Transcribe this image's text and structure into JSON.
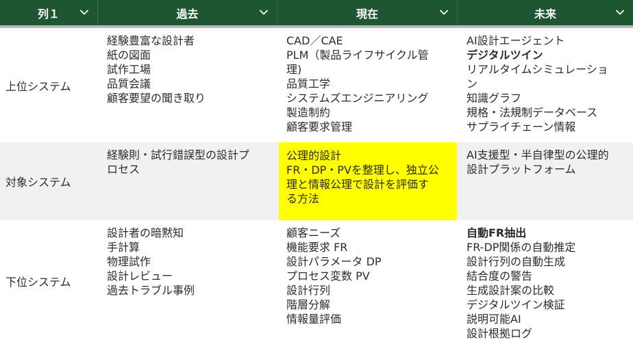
{
  "header": {
    "col0": "列１",
    "col1": "過去",
    "col2": "現在",
    "col3": "未来"
  },
  "rows": [
    {
      "label": "上位システム",
      "past": [
        "経験豊富な設計者",
        "紙の図面",
        "試作工場",
        "品質会議",
        "顧客要望の聞き取り"
      ],
      "present": [
        "CAD／CAE",
        "PLM（製品ライフサイクル管",
        "理)",
        "品質工学",
        "システムズエンジニアリング",
        "製造制約",
        "顧客要求管理"
      ],
      "future": [
        "AI設計エージェント",
        "デジタルツイン",
        "リアルタイムシミュレーショ",
        "ン",
        "知識グラフ",
        "規格・法規制データベース",
        "サプライチェーン情報"
      ]
    },
    {
      "label": "対象システム",
      "past": [
        "経験則・試行錯誤型の設計プ",
        "ロセス"
      ],
      "present": [
        "公理的設計",
        "FR・DP・PVを整理し、独立公",
        "理と情報公理で設計を評価す",
        "る方法"
      ],
      "future": [
        "AI支援型・半自律型の公理的",
        "設計プラットフォーム"
      ]
    },
    {
      "label": "下位システム",
      "past": [
        "設計者の暗黙知",
        "手計算",
        "物理試作",
        "設計レビュー",
        "過去トラブル事例"
      ],
      "present": [
        "顧客ニーズ",
        "機能要求 FR",
        "設計パラメータ DP",
        "プロセス変数 PV",
        "設計行列",
        "階層分解",
        "情報量評価"
      ],
      "future": [
        "自動FR抽出",
        "FR-DP関係の自動推定",
        "設計行列の自動生成",
        "結合度の警告",
        "生成設計案の比較",
        "デジタルツイン検証",
        "説明可能AI",
        "設計根拠ログ"
      ]
    }
  ],
  "colors": {
    "header_bg": "#1e5631",
    "highlight": "#ffff00",
    "alt_row": "#f1f1f1"
  }
}
